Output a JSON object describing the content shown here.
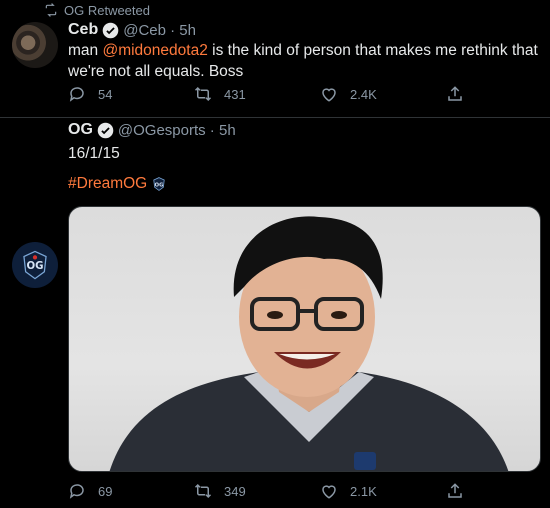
{
  "retweet": {
    "label": "OG Retweeted"
  },
  "tweet1": {
    "display_name": "Ceb",
    "handle": "@Ceb · 5h",
    "text_before": "man ",
    "mention": "@midonedota2",
    "text_after": "  is the kind of person that makes me rethink that we're not all equals. Boss",
    "replies": "54",
    "retweets": "431",
    "likes": "2.4K"
  },
  "tweet2": {
    "display_name": "OG",
    "handle": "@OGesports · 5h",
    "text": "16/1/15",
    "hashtag": "#DreamOG",
    "replies": "69",
    "retweets": "349",
    "likes": "2.1K"
  },
  "colors": {
    "background": "#000000",
    "link": "#ff7a3d",
    "muted": "#8b98a5",
    "verified": "#1d9bf0"
  },
  "icons": [
    "retweet-icon",
    "verified-icon",
    "reply-icon",
    "like-icon",
    "share-icon",
    "og-logo-icon"
  ]
}
